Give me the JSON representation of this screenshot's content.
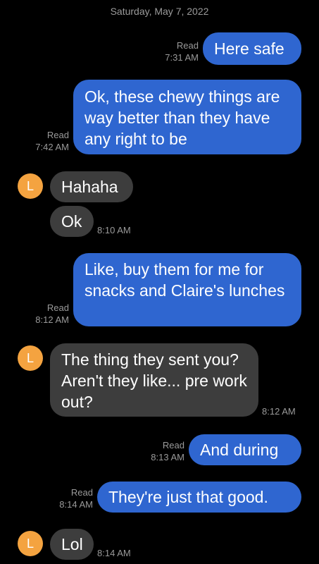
{
  "date_header": "Saturday, May 7, 2022",
  "contact": {
    "avatar_letter": "L",
    "avatar_color": "#f4a340"
  },
  "colors": {
    "outgoing": "#2f66d0",
    "incoming": "#3d3d3d",
    "background": "#000000"
  },
  "messages": [
    {
      "dir": "out",
      "text": "Here safe",
      "status": "Read",
      "time": "7:31 AM"
    },
    {
      "dir": "out",
      "text": "Ok, these chewy things are way better than they have any right to be",
      "status": "Read",
      "time": "7:42 AM"
    },
    {
      "dir": "in",
      "text": "Hahaha",
      "time": ""
    },
    {
      "dir": "in",
      "text": "Ok",
      "time": "8:10 AM"
    },
    {
      "dir": "out",
      "text": "Like, buy them for me for snacks and Claire's lunches",
      "status": "Read",
      "time": "8:12 AM"
    },
    {
      "dir": "in",
      "text": "The thing they sent you? Aren't they like... pre work out?",
      "time": "8:12 AM"
    },
    {
      "dir": "out",
      "text": "And during",
      "status": "Read",
      "time": "8:13 AM"
    },
    {
      "dir": "out",
      "text": "They're just that good.",
      "status": "Read",
      "time": "8:14 AM"
    },
    {
      "dir": "in",
      "text": "Lol",
      "time": "8:14 AM"
    }
  ]
}
